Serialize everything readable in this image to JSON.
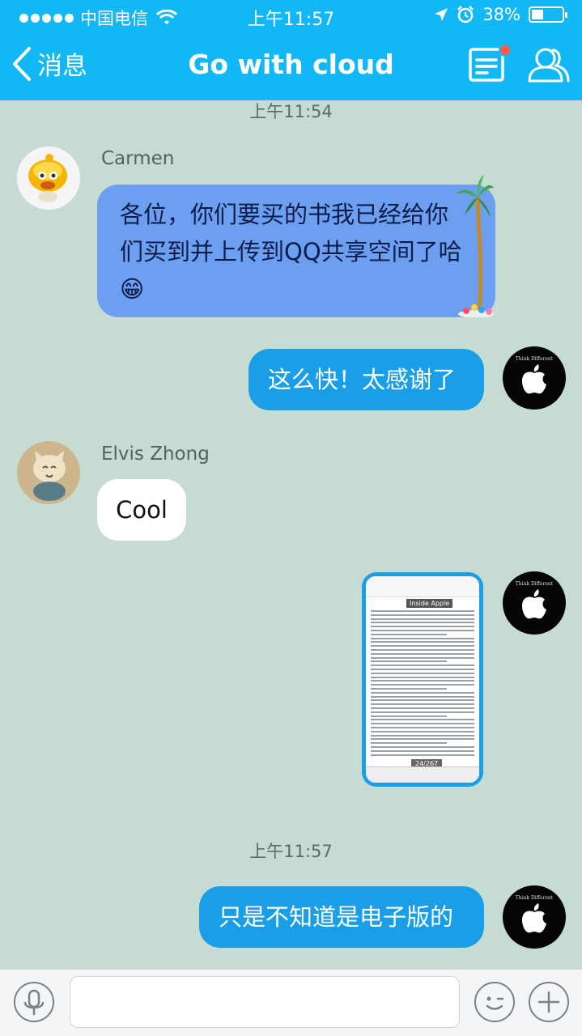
{
  "status_bar": {
    "carrier": "中国电信",
    "time": "上午11:57",
    "battery": "38%",
    "battery_level": 0.38
  },
  "nav": {
    "back_label": "消息",
    "title": "Go with cloud"
  },
  "messages": {
    "time1": "上午11:54",
    "carmen_name": "Carmen",
    "carmen_text": "各位，你们要买的书我已经给你们买到并上传到QQ共享空间了哈😁",
    "me_text1": "这么快！太感谢了",
    "elvis_name": "Elvis Zhong",
    "elvis_text": "Cool",
    "time2": "上午11:57",
    "me_text2": "只是不知道是电子版的"
  },
  "thumbnail": {
    "tag": "Inside Apple",
    "page": "24/267"
  },
  "my_avatar_text": "Think Different",
  "input": {
    "placeholder": ""
  },
  "colors": {
    "nav": "#12b7f5",
    "bubble_blue": "#1a9ee7",
    "bubble_purple": "#6d9ff0",
    "chat_bg": "#c6dcd3"
  }
}
